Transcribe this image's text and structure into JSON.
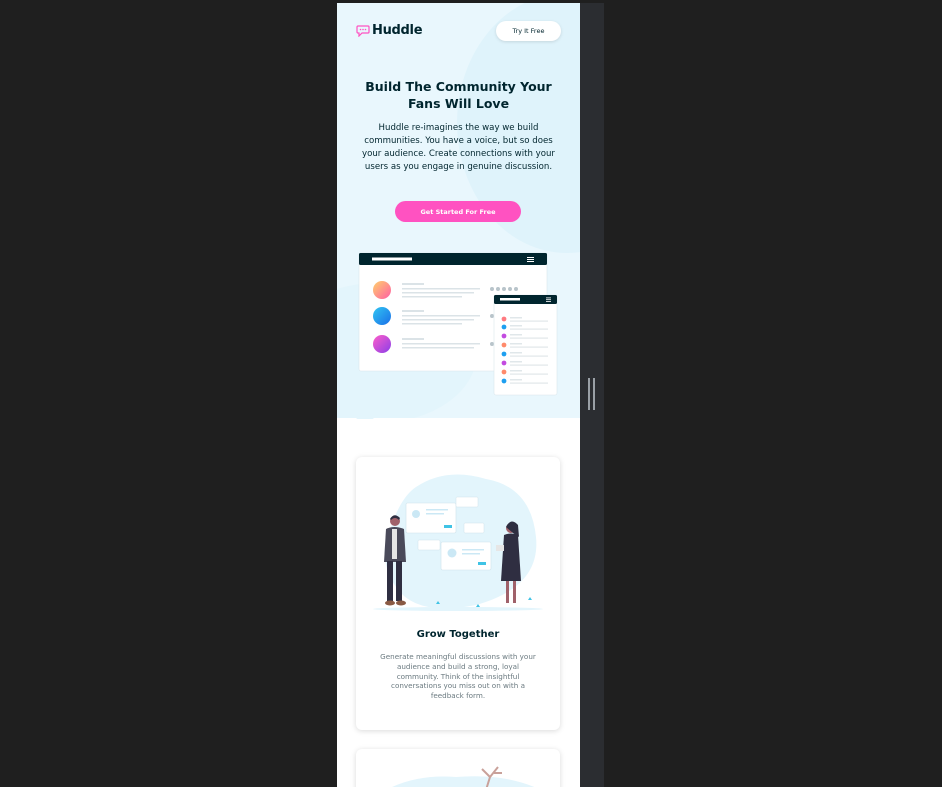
{
  "brand": {
    "name": "Huddle",
    "accent": "#ff52c1",
    "dark": "#00252e",
    "hero_bg": "#e9f7fd"
  },
  "header": {
    "try_label": "Try It Free"
  },
  "hero": {
    "title": "Build The Community Your Fans Will Love",
    "description": "Huddle re-imagines the way we build communities. You have a voice, but so does your audience. Create connections with your users as you engage in genuine discussion.",
    "cta_label": "Get Started For Free"
  },
  "features": [
    {
      "title": "Grow Together",
      "description": "Generate meaningful discussions with your audience and build a strong, loyal community. Think of the insightful conversations you miss out on with a feedback form."
    }
  ],
  "icons": [
    "chat-bubble-logo-icon",
    "hamburger-menu-icon",
    "resize-handle-icon"
  ]
}
